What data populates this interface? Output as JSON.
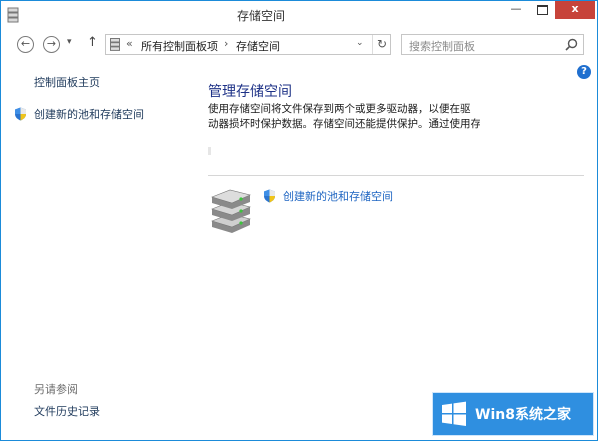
{
  "window": {
    "title": "存储空间",
    "controls": {
      "minimize": "—",
      "close": "x"
    }
  },
  "nav": {
    "back_icon": "arrow-left-icon",
    "forward_icon": "arrow-right-icon",
    "recent_icon": "chevron-down-icon",
    "up_icon": "arrow-up-icon",
    "up_glyph": "↑",
    "back_glyph": "←",
    "forward_glyph": "→",
    "recent_glyph": "▾",
    "address": {
      "overflow": "«",
      "crumbs": [
        "所有控制面板项",
        "存储空间"
      ],
      "separator": "›",
      "dropdown_glyph": "⌄",
      "refresh_glyph": "↻"
    },
    "search": {
      "placeholder": "搜索控制面板"
    }
  },
  "left_pane": {
    "home": "控制面板主页",
    "task": "创建新的池和存储空间",
    "see_also_header": "另请参阅",
    "see_also": [
      "文件历史记录"
    ]
  },
  "main": {
    "title": "管理存储空间",
    "description_lines": [
      "使用存储空间将文件保存到两个或更多驱动器，以便在驱",
      "动器损坏时保护数据。存储空间还能提供保护。通过使用存储空间，你还"
    ],
    "create_link": "创建新的池和存储空间"
  },
  "help": {
    "glyph": "?"
  },
  "watermark": {
    "text": "Win8系统之家"
  },
  "colors": {
    "accent": "#1b8bd9",
    "link": "#1e395b",
    "heading": "#1e3287",
    "watermark_bg": "#2f8fe0"
  }
}
